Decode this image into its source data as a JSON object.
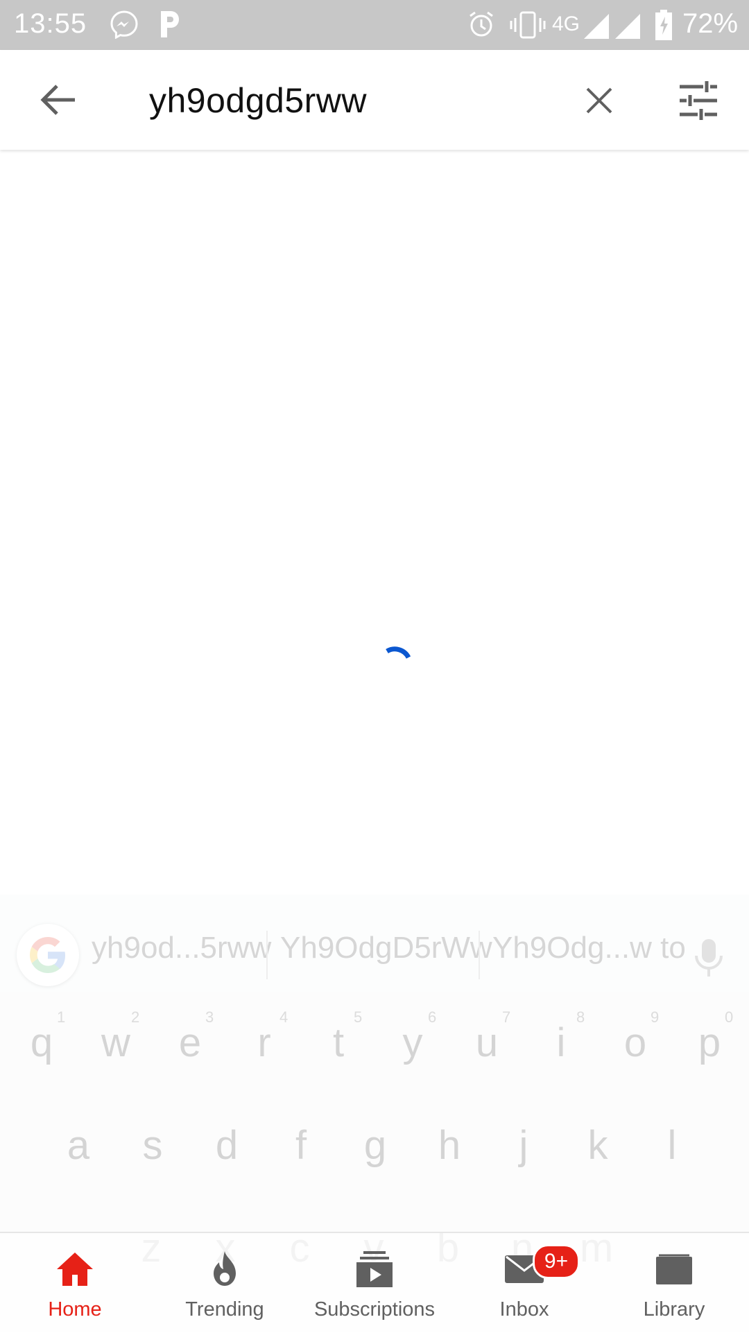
{
  "status_bar": {
    "time": "13:55",
    "network": "4G",
    "battery": "72%"
  },
  "search": {
    "query": "yh9odgd5rww"
  },
  "keyboard": {
    "suggestions": [
      "yh9od...5rww",
      "Yh9OdgD5rWw",
      "Yh9Odg...w to"
    ],
    "row1": [
      "q",
      "w",
      "e",
      "r",
      "t",
      "y",
      "u",
      "i",
      "o",
      "p"
    ],
    "row1_numbers": [
      "1",
      "2",
      "3",
      "4",
      "5",
      "6",
      "7",
      "8",
      "9",
      "0"
    ],
    "row2": [
      "a",
      "s",
      "d",
      "f",
      "g",
      "h",
      "j",
      "k",
      "l"
    ],
    "row3": [
      "z",
      "x",
      "c",
      "v",
      "b",
      "n",
      "m"
    ]
  },
  "bottom_nav": {
    "items": [
      {
        "label": "Home",
        "icon": "home-icon",
        "active": true
      },
      {
        "label": "Trending",
        "icon": "trending-icon",
        "active": false
      },
      {
        "label": "Subscriptions",
        "icon": "subscriptions-icon",
        "active": false
      },
      {
        "label": "Inbox",
        "icon": "inbox-icon",
        "active": false
      },
      {
        "label": "Library",
        "icon": "library-icon",
        "active": false
      }
    ],
    "inbox_badge": "9+"
  },
  "colors": {
    "accent": "#e62117",
    "spinner": "#0b57d0",
    "status_bar_bg": "#c7c7c7"
  }
}
